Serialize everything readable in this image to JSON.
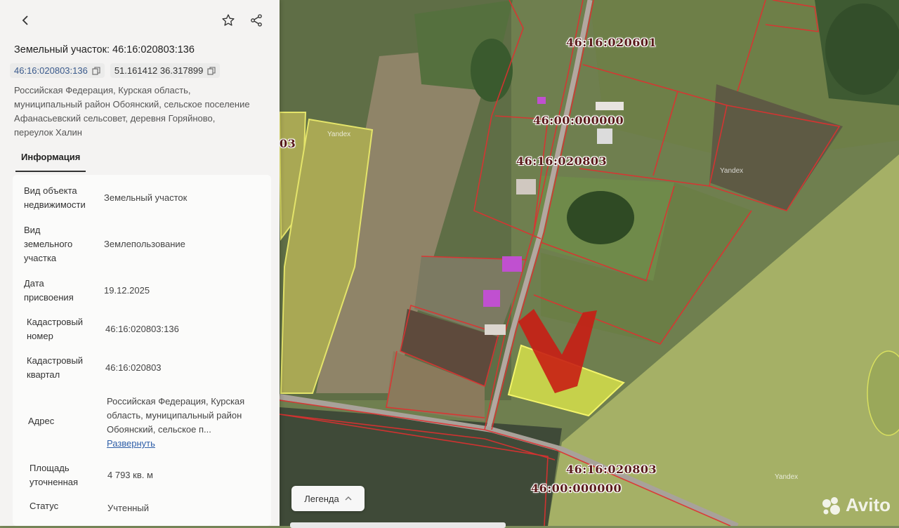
{
  "panel": {
    "title": "Земельный участок: 46:16:020803:136",
    "chip_cadastral": "46:16:020803:136",
    "chip_coords": "51.161412 36.317899",
    "address_lines": [
      "Российская Федерация, Курская область,",
      "муниципальный район Обоянский, сельское поселение",
      "Афанасьевский сельсовет, деревня Горяйново,",
      "переулок Халин"
    ],
    "tab_info": "Информация",
    "rows": [
      {
        "key": "Вид объекта недвижимости",
        "value": "Земельный участок"
      },
      {
        "key": "Вид земельного участка",
        "value": "Землепользование"
      },
      {
        "key": "Дата присвоения",
        "value": "19.12.2025"
      },
      {
        "key": "Кадастровый номер",
        "value": "46:16:020803:136"
      },
      {
        "key": "Кадастровый квартал",
        "value": "46:16:020803"
      },
      {
        "key": "Адрес",
        "value": "Российская Федерация, Курская область, муниципальный район Обоянский, сельское п...",
        "link": "Развернуть"
      },
      {
        "key": "Площадь уточненная",
        "value": "4 793 кв. м"
      },
      {
        "key": "Статус",
        "value": "Учтенный"
      }
    ]
  },
  "map": {
    "labels": [
      "46:16:020601",
      "46:00:000000",
      "46:16:020803",
      "46:16:020803",
      "46:00:000000",
      "03"
    ],
    "legend_label": "Легенда",
    "yandex_mark": "Yandex",
    "watermark": "Avito"
  },
  "icons": {
    "back": "chevron-left-icon",
    "favorite": "star-icon",
    "share": "share-icon",
    "copy": "copy-icon",
    "legend_toggle": "chevron-up-icon"
  }
}
